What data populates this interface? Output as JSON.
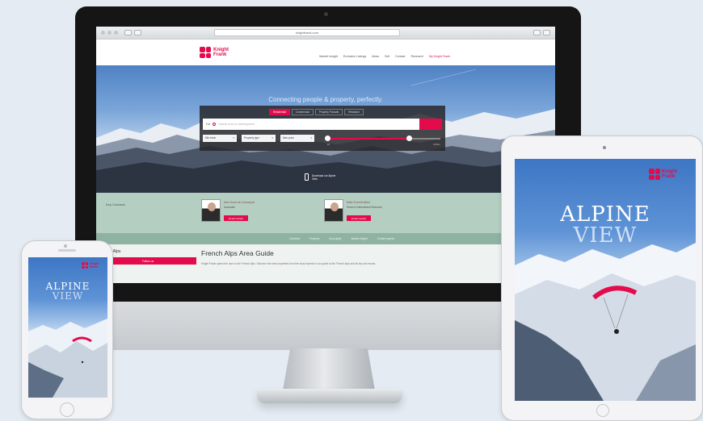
{
  "desktop": {
    "url": "knightfrank.com",
    "brand": {
      "name": "Knight Frank"
    },
    "nav": [
      "Market Insight",
      "Exclusive Listings",
      "Ideas",
      "Sell",
      "Contact",
      "Research",
      "My Knight Frank"
    ],
    "hero": {
      "title": "Connecting people & property, perfectly.",
      "tabs": [
        "Residential",
        "Commercial",
        "Property Pursuits",
        "Research"
      ],
      "search": {
        "for_label": "For",
        "placeholder": "Search town or development",
        "button_icon": "search-icon"
      },
      "filters": [
        "Min beds",
        "Property type",
        "Max price"
      ],
      "slider": {
        "min_label": "£0",
        "max_label": "£10M+",
        "fill_fraction": 0.72
      },
      "download": {
        "text": "Download our Alpine View"
      }
    },
    "contacts": {
      "label": "Key Contacts",
      "people": [
        {
          "name": "Alex Koch de Gooreynd",
          "role": "Associate",
          "button": "Email contact"
        },
        {
          "name": "Kate Everett-Allen",
          "role": "Head of International Research",
          "button": "Email contact"
        }
      ]
    },
    "subnav": [
      "Overview",
      "Property",
      "Area guide",
      "Market Insight",
      "Contact agents"
    ],
    "guide": {
      "area_title": "French Alps",
      "area_button": "Follow us",
      "title": "French Alps Area Guide",
      "text": "Knight Frank opens the door to the French Alps. Discover the best properties from the local experts in our guide to the French Alps and its key ski resorts."
    }
  },
  "cover": {
    "brand": "Knight Frank",
    "title_line1": "ALPINE",
    "title_line2": "VIEW"
  },
  "colors": {
    "brand_red": "#e30b4c",
    "contacts_band": "#b4cfc2",
    "subnav_band": "#8fb3a2"
  }
}
